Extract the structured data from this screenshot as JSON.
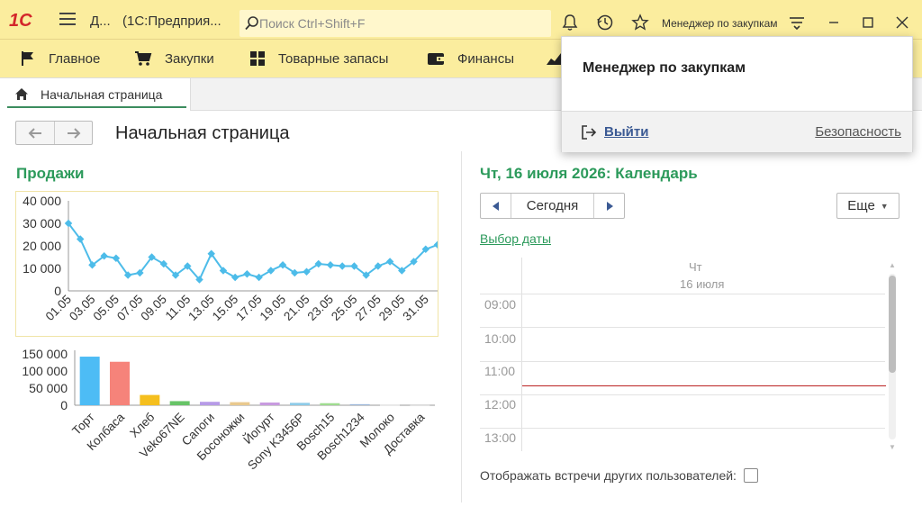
{
  "app": {
    "logo_text": "1С",
    "window_short": "Д...",
    "window_title": "(1С:Предприя...",
    "search_placeholder": "Поиск Ctrl+Shift+F",
    "user": "Менеджер по закупкам"
  },
  "sections": [
    {
      "label": "Главное",
      "icon": "flag-icon"
    },
    {
      "label": "Закупки",
      "icon": "cart-icon"
    },
    {
      "label": "Товарные запасы",
      "icon": "grid-icon"
    },
    {
      "label": "Финансы",
      "icon": "wallet-icon"
    }
  ],
  "tabs": [
    {
      "label": "Начальная страница",
      "icon": "home-icon"
    }
  ],
  "page": {
    "title": "Начальная страница"
  },
  "sales": {
    "title": "Продажи"
  },
  "calendar": {
    "title": "Чт, 16 июля 2026: Календарь",
    "today_label": "Сегодня",
    "more_label": "Еще",
    "date_pick_label": "Выбор даты",
    "day_name": "Чт",
    "day_date": "16 июля",
    "hours": [
      "09:00",
      "10:00",
      "11:00",
      "12:00",
      "13:00"
    ],
    "current_time": "11:40",
    "show_others_label": "Отображать встречи других пользователей:",
    "show_others_checked": false
  },
  "popup": {
    "user_name": "Менеджер по закупкам",
    "exit_label": "Выйти",
    "security_label": "Безопасность"
  },
  "colors": {
    "accent_green": "#2c9a5b",
    "title_bar": "#fbed9e",
    "line_series": "#4dbce9"
  },
  "chart_data": [
    {
      "type": "line",
      "title": "",
      "x": [
        "01.05",
        "02.05",
        "03.05",
        "04.05",
        "05.05",
        "06.05",
        "07.05",
        "08.05",
        "09.05",
        "10.05",
        "11.05",
        "12.05",
        "13.05",
        "14.05",
        "15.05",
        "16.05",
        "17.05",
        "18.05",
        "19.05",
        "20.05",
        "21.05",
        "22.05",
        "23.05",
        "24.05",
        "25.05",
        "26.05",
        "27.05",
        "28.05",
        "29.05",
        "30.05",
        "31.05",
        "01.06"
      ],
      "tick_labels": [
        "01.05",
        "03.05",
        "05.05",
        "07.05",
        "09.05",
        "11.05",
        "13.05",
        "15.05",
        "17.05",
        "19.05",
        "21.05",
        "23.05",
        "25.05",
        "27.05",
        "29.05",
        "31.05"
      ],
      "series": [
        {
          "values": [
            30000,
            23000,
            11500,
            15500,
            14500,
            7000,
            8000,
            15000,
            12000,
            7000,
            11000,
            5000,
            16500,
            9000,
            6000,
            7500,
            6000,
            9000,
            11500,
            8000,
            8500,
            12000,
            11500,
            11000,
            11000,
            7000,
            11000,
            13000,
            9000,
            13000,
            18500,
            20500
          ]
        }
      ],
      "ylim": [
        0,
        40000
      ],
      "yticks": [
        "0",
        "10 000",
        "20 000",
        "30 000",
        "40 000"
      ],
      "grid": false
    },
    {
      "type": "bar",
      "title": "",
      "categories": [
        "Торт",
        "Колбаса",
        "Хлеб",
        "Veko67NE",
        "Сапоги",
        "Босоножки",
        "Йогурт",
        "Sony K3456P",
        "Bosch15",
        "Bosch1234",
        "Молоко",
        "Доставка"
      ],
      "values": [
        142000,
        127000,
        30000,
        12000,
        10000,
        9000,
        8000,
        7000,
        6000,
        3000,
        1000,
        500
      ],
      "colors": [
        "#4dbcf5",
        "#f6837a",
        "#f5bf1e",
        "#67c467",
        "#b79be7",
        "#e9c98e",
        "#c89be0",
        "#8dcbe8",
        "#9fdc8f",
        "#9ab6d9",
        "#dddddd",
        "#dddddd"
      ],
      "ylim": [
        0,
        150000
      ],
      "yticks": [
        "0",
        "50 000",
        "100 000",
        "150 000"
      ]
    }
  ]
}
